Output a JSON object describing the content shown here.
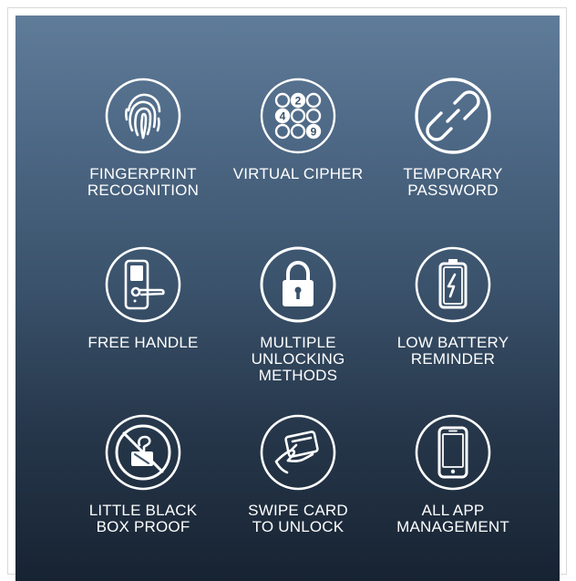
{
  "features": [
    {
      "icon": "fingerprint-icon",
      "label": "FINGERPRINT\nRECOGNITION"
    },
    {
      "icon": "keypad-icon",
      "label": "VIRTUAL CIPHER",
      "keypad_digits": [
        "2",
        "4",
        "9"
      ]
    },
    {
      "icon": "temporary-password-icon",
      "label": "TEMPORARY\nPASSWORD"
    },
    {
      "icon": "door-handle-icon",
      "label": "FREE HANDLE"
    },
    {
      "icon": "padlock-icon",
      "label": "MULTIPLE\nUNLOCKING\nMETHODS"
    },
    {
      "icon": "low-battery-icon",
      "label": "LOW BATTERY\nREMINDER"
    },
    {
      "icon": "no-black-box-icon",
      "label": "LITTLE BLACK\nBOX PROOF"
    },
    {
      "icon": "swipe-card-icon",
      "label": "SWIPE CARD\nTO UNLOCK"
    },
    {
      "icon": "smartphone-icon",
      "label": "ALL APP\nMANAGEMENT"
    }
  ],
  "colors": {
    "gradient_top": "#5f7c99",
    "gradient_bottom": "#172332",
    "icon_stroke": "#ffffff",
    "label_text": "#ffffff"
  }
}
